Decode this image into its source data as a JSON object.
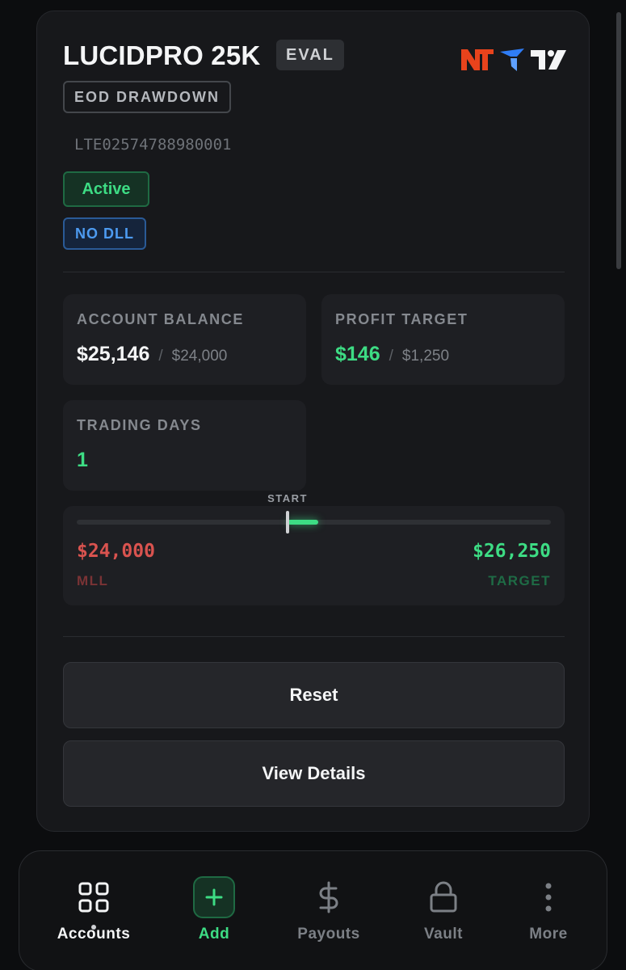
{
  "account": {
    "name": "LUCIDPRO 25K",
    "phase_badge": "EVAL",
    "drawdown_type": "EOD DRAWDOWN",
    "account_id": "LTE02574788980001",
    "status": "Active",
    "dll_badge": "NO DLL",
    "platform_icons": [
      "ninjatrader-icon",
      "tradovate-icon",
      "tradingview-icon"
    ]
  },
  "stats": {
    "balance": {
      "label": "ACCOUNT BALANCE",
      "value": "$25,146",
      "separator": "/",
      "sub": "$24,000"
    },
    "profit_target": {
      "label": "PROFIT TARGET",
      "value": "$146",
      "separator": "/",
      "sub": "$1,250"
    },
    "trading_days": {
      "label": "TRADING DAYS",
      "value": "1"
    }
  },
  "progress": {
    "start_label": "START",
    "mll_value": "$24,000",
    "mll_label": "MLL",
    "target_value": "$26,250",
    "target_label": "TARGET"
  },
  "actions": {
    "reset_label": "Reset",
    "details_label": "View Details"
  },
  "nav": {
    "items": [
      {
        "label": "Accounts",
        "icon": "grid-icon",
        "active": true
      },
      {
        "label": "Add",
        "icon": "plus-icon",
        "active": false
      },
      {
        "label": "Payouts",
        "icon": "dollar-icon",
        "active": false
      },
      {
        "label": "Vault",
        "icon": "lock-icon",
        "active": false
      },
      {
        "label": "More",
        "icon": "more-vertical-icon",
        "active": false
      }
    ]
  },
  "colors": {
    "accent_green": "#3ddc84",
    "danger_red": "#d9534f",
    "info_blue": "#4d9bf0",
    "card_bg": "#17181b",
    "page_bg": "#0c0d0f",
    "ninjatrader_orange": "#e8431c",
    "tradovate_blue": "#2f7df6"
  }
}
